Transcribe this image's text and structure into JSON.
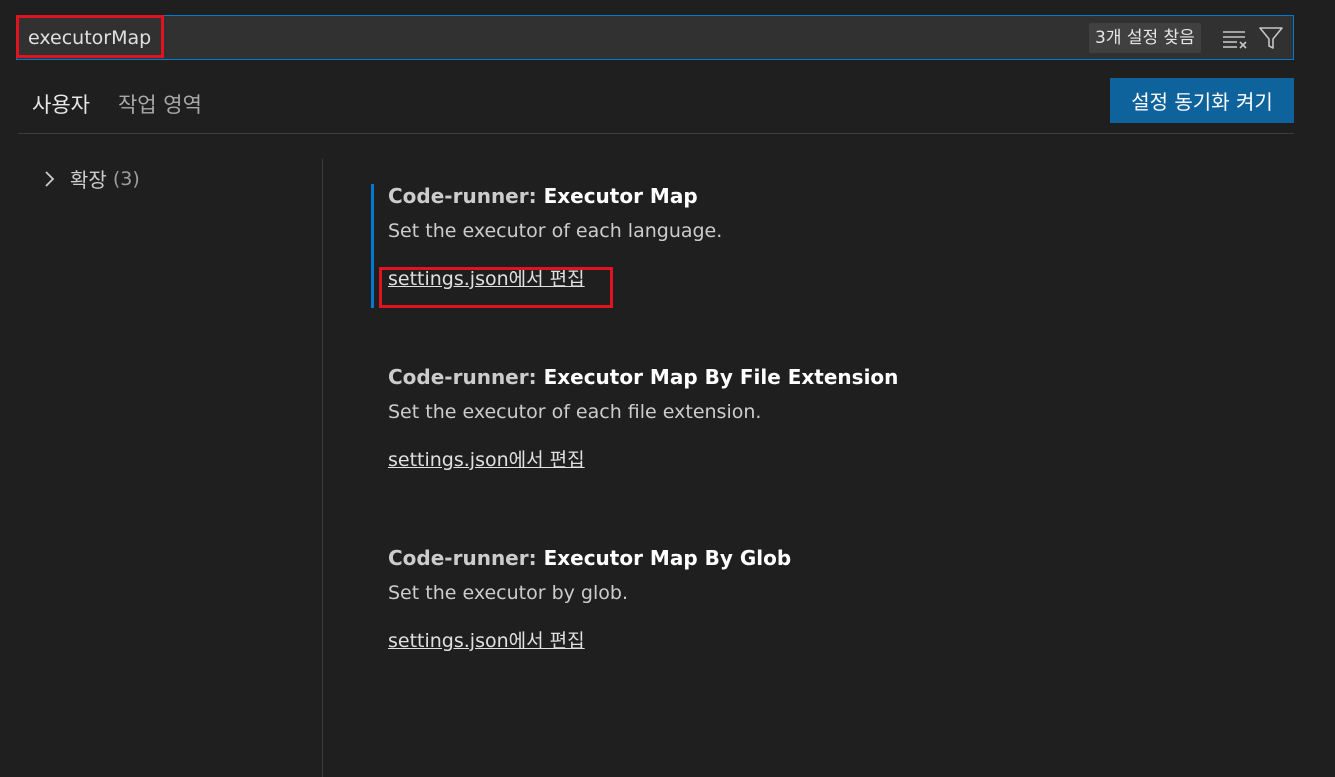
{
  "search": {
    "query": "executorMap",
    "result_count": "3개 설정 찾음",
    "clear_icon": "clear-filter-icon",
    "filter_icon": "filter-icon"
  },
  "tabs": [
    {
      "label": "사용자",
      "active": true
    },
    {
      "label": "작업 영역",
      "active": false
    }
  ],
  "sync_button": {
    "label": "설정 동기화 켜기"
  },
  "toc": {
    "items": [
      {
        "label": "확장",
        "count": "(3)",
        "icon": "chevron-right-icon"
      }
    ]
  },
  "settings": [
    {
      "category": "Code-runner: ",
      "name": "Executor Map",
      "description": "Set the executor of each language.",
      "link": "settings.json에서 편집"
    },
    {
      "category": "Code-runner: ",
      "name": "Executor Map By File Extension",
      "description": "Set the executor of each file extension.",
      "link": "settings.json에서 편집"
    },
    {
      "category": "Code-runner: ",
      "name": "Executor Map By Glob",
      "description": "Set the executor by glob.",
      "link": "settings.json에서 편집"
    }
  ],
  "colors": {
    "background": "#1f1f1f",
    "accent": "#0078d4",
    "button": "#0e639c",
    "highlight": "#e0141e"
  }
}
